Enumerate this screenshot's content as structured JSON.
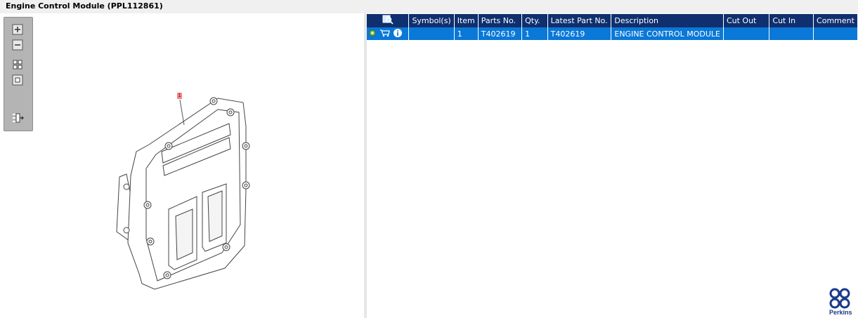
{
  "window": {
    "title": "Engine Control Module (PPL112861)"
  },
  "toolbox": {
    "icons": [
      "zoom-in-icon",
      "zoom-out-icon",
      "fit-all-icon",
      "fit-window-icon",
      "export-list-icon"
    ]
  },
  "drawing": {
    "callout_label": "1"
  },
  "parts_table": {
    "columns": {
      "symbols": "Symbol(s)",
      "item": "Item",
      "parts_no": "Parts No.",
      "qty": "Qty.",
      "latest_part_no": "Latest Part No.",
      "description": "Description",
      "cut_out": "Cut Out",
      "cut_in": "Cut In",
      "comment": "Comment"
    },
    "rows": [
      {
        "symbols": "",
        "item": "1",
        "parts_no": "T402619",
        "qty": "1",
        "latest_part_no": "T402619",
        "description": "ENGINE CONTROL MODULE",
        "cut_out": "",
        "cut_in": "",
        "comment": ""
      }
    ],
    "selected_row_color": "#0a78d7",
    "header_color": "#0f2f6e"
  },
  "brand": {
    "logo_text": "Perkins"
  }
}
